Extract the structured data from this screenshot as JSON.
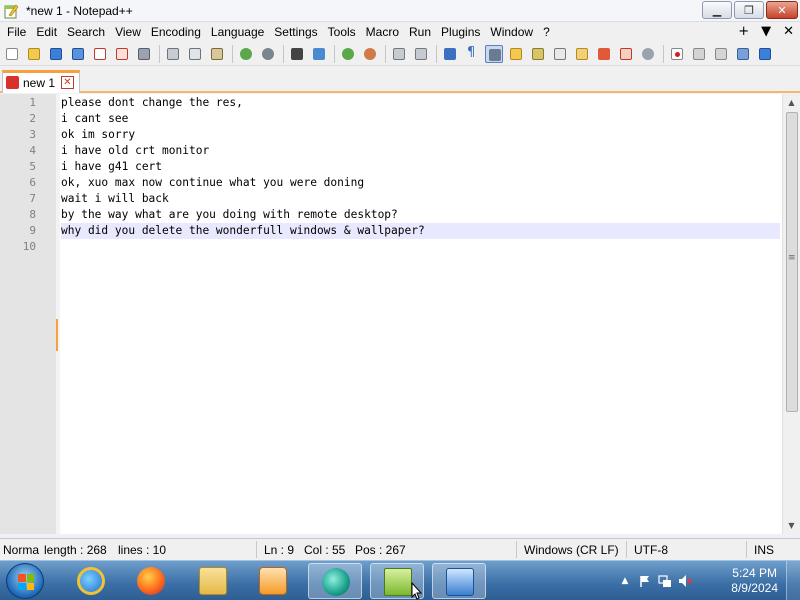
{
  "window": {
    "title": "*new 1 - Notepad++",
    "controls": {
      "minimize": "▁",
      "maximize": "❐",
      "close": "✕"
    }
  },
  "menu": {
    "items": [
      "File",
      "Edit",
      "Search",
      "View",
      "Encoding",
      "Language",
      "Settings",
      "Tools",
      "Macro",
      "Run",
      "Plugins",
      "Window",
      "?"
    ],
    "right": [
      "+",
      "▼",
      "✕"
    ]
  },
  "toolbar": {
    "icons": [
      "new-file",
      "open-file",
      "save",
      "save-all",
      "close",
      "close-all",
      "print",
      "cut",
      "copy",
      "paste",
      "undo",
      "redo",
      "find",
      "replace",
      "zoom-in",
      "zoom-out",
      "sync-vertical",
      "sync-horizontal",
      "word-wrap",
      "show-all-characters",
      "indent-guide",
      "user-defined-language",
      "doc-map",
      "function-list",
      "folder-as-workspace",
      "monitoring",
      "record-macro",
      "stop-recording",
      "playback-macro",
      "run-macro-multiple",
      "save-macro"
    ]
  },
  "tabs": [
    {
      "label": "new 1",
      "close": "✕"
    }
  ],
  "editor": {
    "line_numbers": [
      "1",
      "2",
      "3",
      "4",
      "5",
      "6",
      "7",
      "8",
      "9",
      "10"
    ],
    "lines": [
      "please dont change the res,",
      "i cant see",
      "ok im sorry",
      "i have old crt monitor",
      "i have g41 cert",
      "ok, xuo max now continue what you were doning",
      "wait i will back",
      "by the way what are you doing with remote desktop?",
      "why did you delete the wonderfull windows & wallpaper?",
      ""
    ],
    "current_line": 9,
    "scroll": {
      "up": "▲",
      "down": "▼",
      "grip": "≡"
    }
  },
  "status": {
    "language": "Norma",
    "length": "length : 268",
    "lines": "lines : 10",
    "ln": "Ln : 9",
    "col": "Col : 55",
    "pos": "Pos : 267",
    "eol": "Windows (CR LF)",
    "encoding": "UTF-8",
    "mode": "INS"
  },
  "taskbar": {
    "apps": [
      "internet-explorer",
      "firefox",
      "file-explorer",
      "media-player",
      "app-teal",
      "notepad-plus-plus",
      "remote-desktop"
    ],
    "active_apps": [
      "notepad-plus-plus",
      "remote-desktop",
      "app-teal"
    ],
    "tray": {
      "show_hidden": "▲"
    },
    "clock": {
      "time": "5:24 PM",
      "date": "8/9/2024"
    }
  },
  "colors": {
    "tab_accent": "#f7a040",
    "current_line": "#e8e8ff",
    "taskbar": "#3a6ea5"
  }
}
